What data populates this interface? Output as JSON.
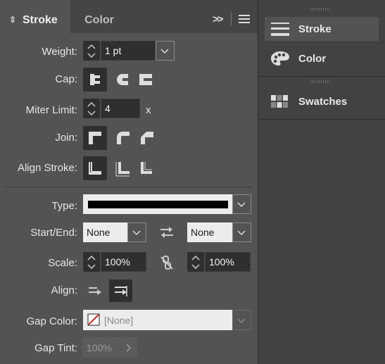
{
  "tabs": {
    "stroke": "Stroke",
    "color": "Color",
    "overflow": ">>"
  },
  "labels": {
    "weight": "Weight:",
    "cap": "Cap:",
    "miter": "Miter Limit:",
    "join": "Join:",
    "align_stroke": "Align Stroke:",
    "type": "Type:",
    "start_end": "Start/End:",
    "scale": "Scale:",
    "align": "Align:",
    "gap_color": "Gap Color:",
    "gap_tint": "Gap Tint:"
  },
  "values": {
    "weight": "1 pt",
    "miter": "4",
    "miter_unit": "x",
    "start": "None",
    "end": "None",
    "scale_start": "100%",
    "scale_end": "100%",
    "gap_color": "[None]",
    "gap_tint": "100%"
  },
  "dock": {
    "items": [
      "Stroke",
      "Color",
      "Swatches"
    ]
  },
  "colors": {
    "panel": "#535353",
    "dock": "#424242",
    "accent_selected": "#2f2f2f"
  }
}
